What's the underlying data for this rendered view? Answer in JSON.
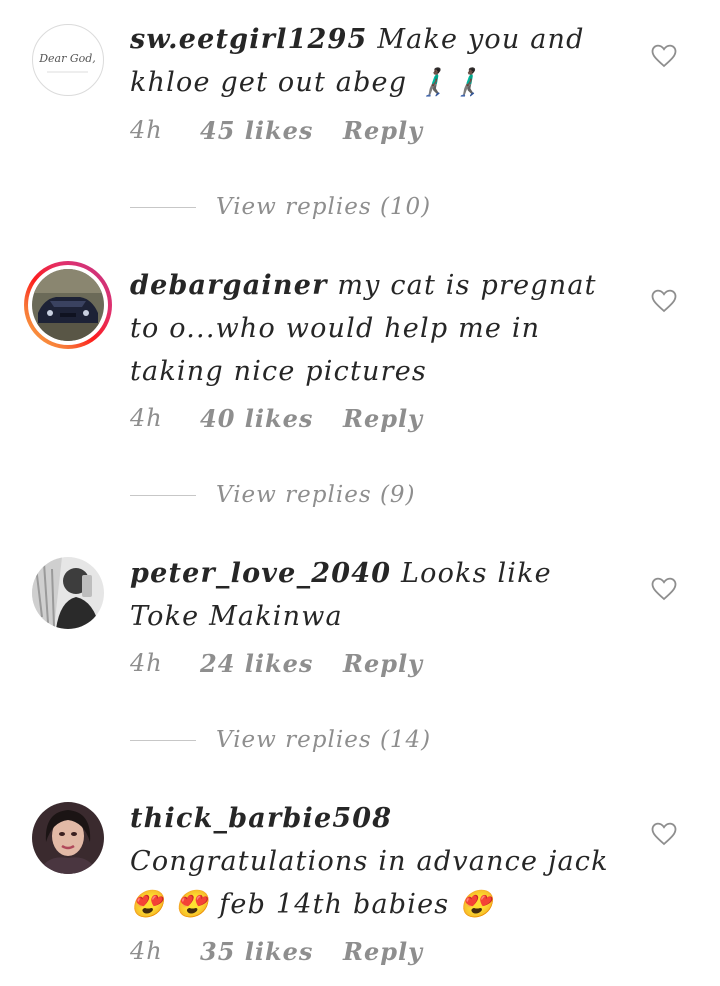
{
  "comments": [
    {
      "username": "sw.eetgirl1295",
      "text": " Make you and khloe get out abeg 🚶🏿‍♂️🚶🏿‍♂️",
      "time": "4h",
      "likes": "45 likes",
      "reply": "Reply",
      "view_replies": "View replies (10)",
      "avatar_text": "Dear God,"
    },
    {
      "username": "debargainer",
      "text": " my cat is pregnat to o...who would help me in taking nice pictures",
      "time": "4h",
      "likes": "40 likes",
      "reply": "Reply",
      "view_replies": "View replies (9)"
    },
    {
      "username": "peter_love_2040",
      "text": " Looks like Toke Makinwa",
      "time": "4h",
      "likes": "24 likes",
      "reply": "Reply",
      "view_replies": "View replies (14)"
    },
    {
      "username": "thick_barbie508",
      "text": " Congratulations in advance jack 😍 😍 feb 14th babies 😍",
      "time": "4h",
      "likes": "35 likes",
      "reply": "Reply"
    }
  ],
  "colors": {
    "text": "#262626",
    "meta": "#8e8e8e",
    "divider": "#c7c7c7",
    "story_ring_start": "#fcaf45",
    "story_ring_end": "#c13584"
  },
  "icons": {
    "like": "heart-outline-icon"
  }
}
